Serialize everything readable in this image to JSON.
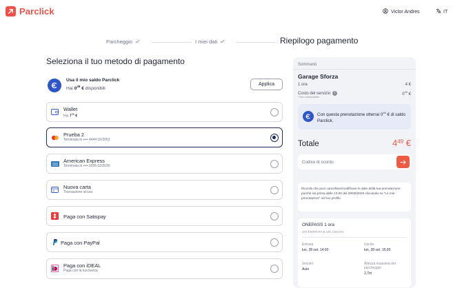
{
  "brand": {
    "name": "Parclick",
    "color": "#f0524a"
  },
  "header": {
    "user_name": "Victor Andres",
    "language": "IT",
    "user_icon": "user-icon",
    "globe_icon": "globe-icon"
  },
  "steps": [
    {
      "label": "Parcheggio",
      "done": true
    },
    {
      "label": "I miei dati",
      "done": true
    },
    {
      "label": "Riepilogo pagamento",
      "active": true
    }
  ],
  "page": {
    "section_title": "Seleziona il tuo metodo di pagamento"
  },
  "balance": {
    "title": "Usa il mio saldo Parclick",
    "prefix": "Hai",
    "amount_main": "0",
    "amount_decimal": "39",
    "currency": "€",
    "suffix": "disponibili",
    "apply_label": "Applica"
  },
  "methods": [
    {
      "title": "Wallet",
      "sub_prefix": "Hai",
      "sub_amount": "7",
      "sub_decimal": "36",
      "sub_currency": "€",
      "icon": "wallet-icon",
      "selected": false
    },
    {
      "title": "Prueba 2",
      "sub": "Terminata in •••• 4444   02/2052",
      "icon": "mastercard-icon",
      "selected": true
    },
    {
      "title": "American Express",
      "sub": "Terminata in •••• 0005   02/2030",
      "icon": "amex-icon",
      "selected": false
    },
    {
      "title": "Nuova carta",
      "sub": "Transazione sicura",
      "icon": "credit-card-icon",
      "selected": false
    },
    {
      "title": "Paga con Satispay",
      "icon": "satispay-icon",
      "selected": false
    },
    {
      "title": "Paga con PayPal",
      "icon": "paypal-icon",
      "selected": false
    },
    {
      "title": "Paga con iDEAL",
      "sub": "Paga con la tua banca",
      "icon": "ideal-icon",
      "selected": false
    }
  ],
  "summary": {
    "header": "Sommario",
    "garage": "Garage Sforza",
    "rows": [
      {
        "label": "1 ora",
        "value_main": "4",
        "value_currency": "€"
      },
      {
        "label": "Costo del servizio",
        "value_main": "0",
        "value_decimal": "49",
        "value_currency": "€"
      }
    ],
    "note": "* Non rimborsabile",
    "promo_part1": "Con questa prenotazione otterrai 0",
    "promo_decimal": "16",
    "promo_part2": "€ di saldo Parclick.",
    "total_label": "Totale",
    "total_main": "4",
    "total_decimal": "49",
    "total_currency": "€",
    "discount_placeholder": "Codice di sconto",
    "policy_text": "Ricorda che puoi cancellare/modificare le date della tua prenotazione purché sia prima delle 13:00 del 28/09/2026 cliccando su \"Le mie prenotazioni\" nel tuo profilo.",
    "pass": {
      "title": "ONEPASS 1 ora",
      "subtitle": "UN' ENTRATA E UN' USCITA",
      "entry_label": "Entrata",
      "entry_value": "lun, 28 set. 14:00",
      "exit_label": "Uscita",
      "exit_value": "lun, 28 set. 15:00",
      "vehicle_label": "Veicolo",
      "vehicle_value": "Auto",
      "height_label": "Altezza massima del parcheggio",
      "height_value": "2,7m"
    }
  },
  "colors": {
    "accent": "#ee5a43",
    "navy": "#1f2a55",
    "blue": "#2e56c8"
  }
}
